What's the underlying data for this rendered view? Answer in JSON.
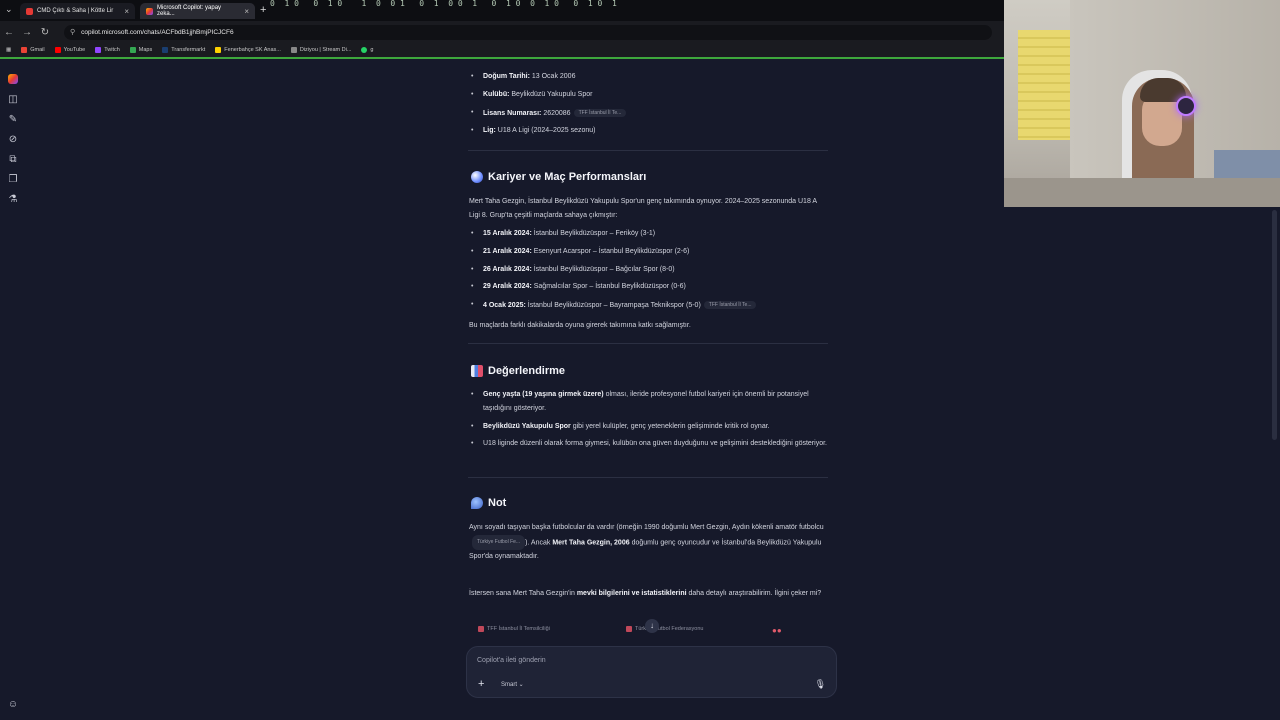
{
  "browser": {
    "tabs": [
      {
        "label": "CMD Çıktı & Saha | Kötte Lir",
        "active": false
      },
      {
        "label": "Microsoft Copilot: yapay zeka...",
        "active": true
      }
    ],
    "url": "copilot.microsoft.com/chats/ACFbdB1jjhBmjPICJCF6",
    "bookmarks": [
      "Gmail",
      "YouTube",
      "Twitch",
      "Maps",
      "Transfermarkt",
      "Fenerbahçe SK Anas...",
      "Diziyou | Stream Di...",
      "g"
    ],
    "matrix_text": "0  1 0   0  1 0    1  0  0 1   0  1  0 0  1   0  1 0  0  1 0   0  1 0  1"
  },
  "profile_items": [
    {
      "label": "Doğum Tarihi:",
      "value": "13 Ocak 2006",
      "cite": ""
    },
    {
      "label": "Kulübü:",
      "value": "Beylikdüzü Yakupulu Spor",
      "cite": ""
    },
    {
      "label": "Lisans Numarası:",
      "value": "2620086",
      "cite": "TFF İstanbul İl Te..."
    },
    {
      "label": "Lig:",
      "value": "U18 A Ligi (2024–2025 sezonu)",
      "cite": ""
    }
  ],
  "section_career": {
    "title": "Kariyer ve Maç Performansları",
    "intro": "Mert Taha Gezgin, İstanbul Beylikdüzü Yakupulu Spor'un genç takımında oynuyor. 2024–2025 sezonunda U18 A Ligi 8. Grup'ta çeşitli maçlarda sahaya çıkmıştır:",
    "matches": [
      {
        "date": "15 Aralık 2024:",
        "text": "İstanbul Beylikdüzüspor – Feriköy (3-1)",
        "cite": ""
      },
      {
        "date": "21 Aralık 2024:",
        "text": "Esenyurt Acarspor – İstanbul Beylikdüzüspor (2-6)",
        "cite": ""
      },
      {
        "date": "26 Aralık 2024:",
        "text": "İstanbul Beylikdüzüspor – Bağcılar Spor (8-0)",
        "cite": ""
      },
      {
        "date": "29 Aralık 2024:",
        "text": "Sağmalcılar Spor – İstanbul Beylikdüzüspor (0-6)",
        "cite": ""
      },
      {
        "date": "4 Ocak 2025:",
        "text": "İstanbul Beylikdüzüspor – Bayrampaşa Teknikspor (5-0)",
        "cite": "TFF İstanbul İl Te..."
      }
    ],
    "outro": "Bu maçlarda farklı dakikalarda oyuna girerek takımına katkı sağlamıştır."
  },
  "section_eval": {
    "title": "Değerlendirme",
    "items": [
      {
        "bold": "Genç yaşta (19 yaşına girmek üzere)",
        "text": " olması, ileride profesyonel futbol kariyeri için önemli bir potansiyel taşıdığını gösteriyor."
      },
      {
        "bold": "Beylikdüzü Yakupulu Spor",
        "text": " gibi yerel kulüpler, genç yeteneklerin gelişiminde kritik rol oynar."
      },
      {
        "bold": "",
        "text": "U18 liginde düzenli olarak forma giymesi, kulübün ona güven duyduğunu ve gelişimini desteklediğini gösteriyor."
      }
    ]
  },
  "section_note": {
    "title": "Not",
    "text_a": "Aynı soyadı taşıyan başka futbolcular da vardır (örneğin 1990 doğumlu Mert Gezgin, Aydın kökenli amatör futbolcu",
    "cite": "Türkiye Futbol Fe...",
    "text_b": "). Ancak",
    "bold": "Mert Taha Gezgin, 2006",
    "text_c": "doğumlu genç oyuncudur ve İstanbul'da Beylikdüzü Yakupulu Spor'da oynamaktadır."
  },
  "followup": {
    "text_a": "İstersen sana Mert Taha Gezgin'in",
    "bold": "mevki bilgilerini ve istatistiklerini",
    "text_b": "daha detaylı araştırabilirim. İlgini çeker mi?"
  },
  "sources": [
    "TFF İstanbul İl Temsilciliği",
    "Türkiye Futbol Federasyonu"
  ],
  "composer": {
    "placeholder": "Copilot'a ileti gönderin",
    "mode": "Smart"
  },
  "colors": {
    "accent_green": "#3ea83c",
    "background": "#16192a"
  }
}
